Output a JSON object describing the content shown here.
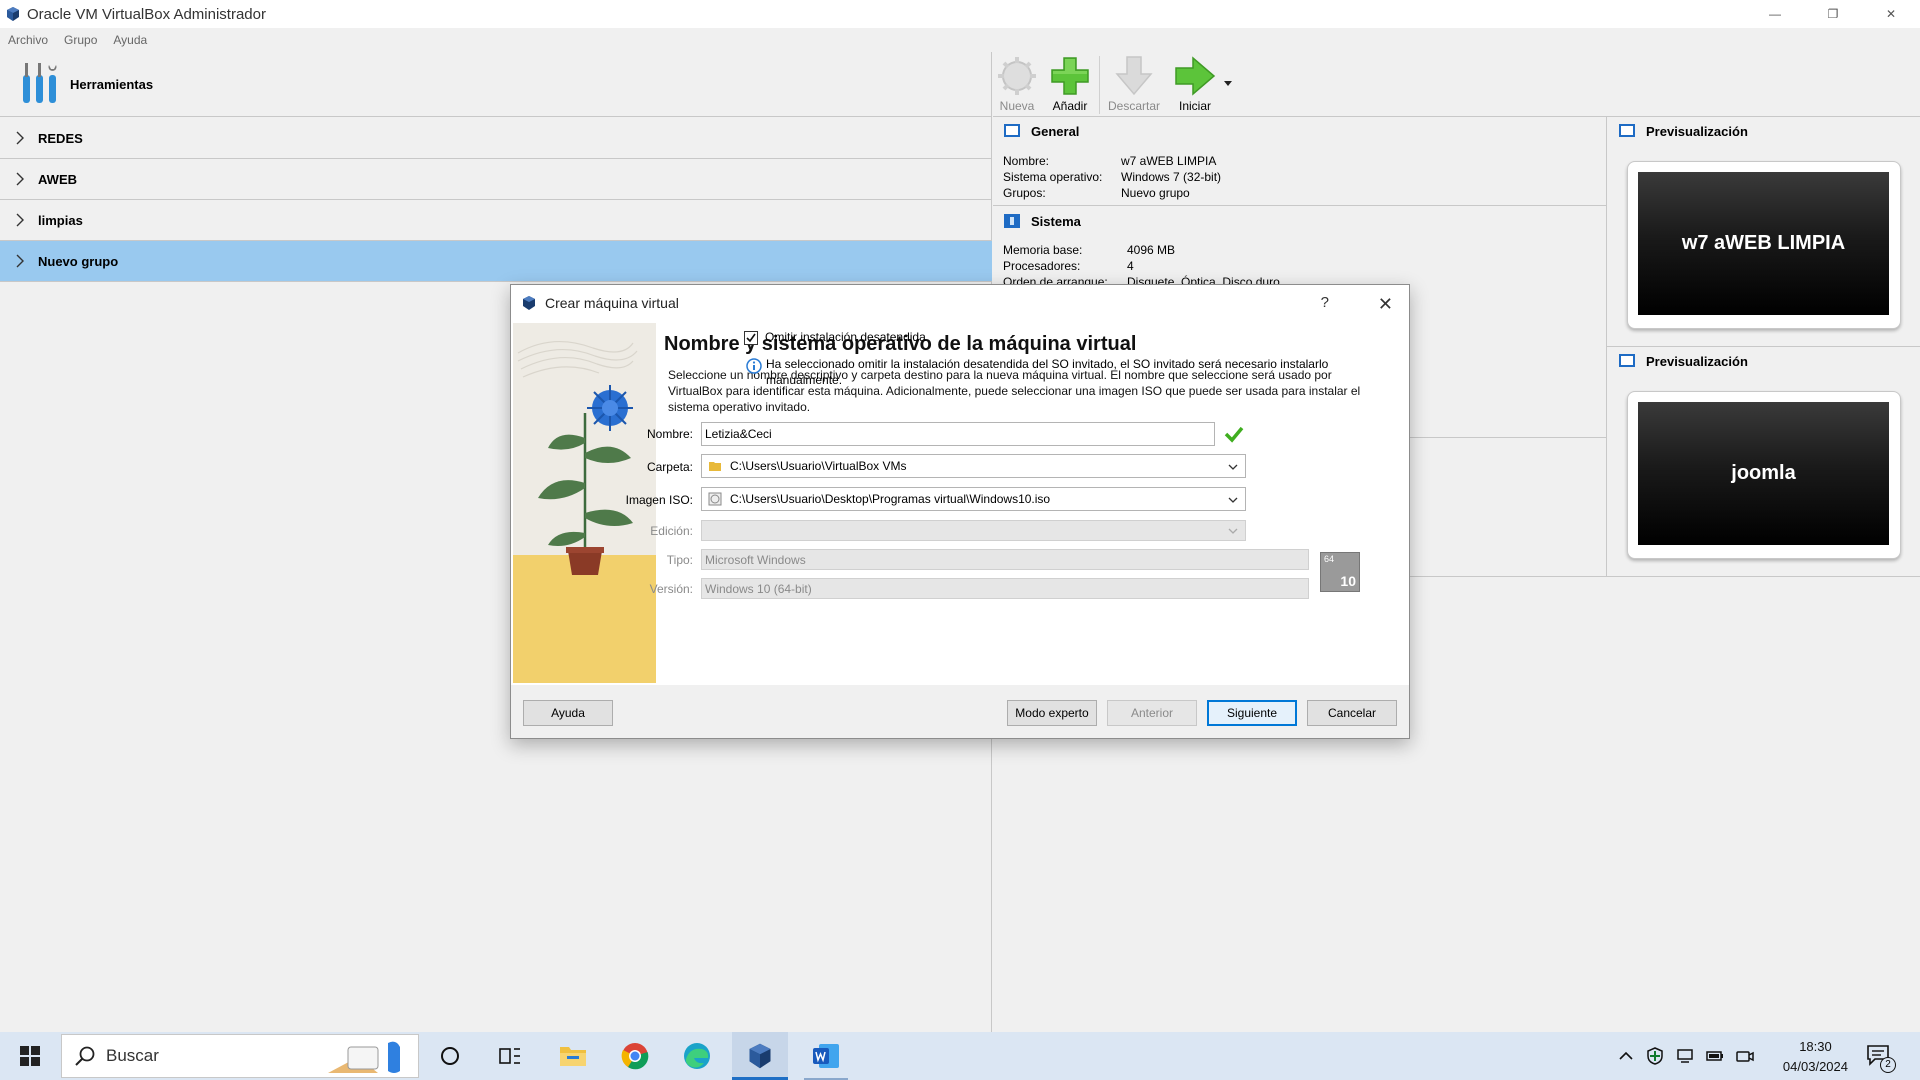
{
  "window": {
    "title": "Oracle VM VirtualBox Administrador",
    "minimize": "—",
    "maximize": "❐",
    "close": "✕"
  },
  "menu": [
    "Archivo",
    "Grupo",
    "Ayuda"
  ],
  "sidebar": {
    "tools_label": "Herramientas",
    "groups": [
      {
        "label": "REDES",
        "selected": false
      },
      {
        "label": "AWEB",
        "selected": false
      },
      {
        "label": "limpias",
        "selected": false
      },
      {
        "label": "Nuevo grupo",
        "selected": true
      }
    ]
  },
  "toolbar": {
    "new_label": "Nueva",
    "add_label": "Añadir",
    "discard_label": "Descartar",
    "start_label": "Iniciar"
  },
  "details": {
    "general_title": "General",
    "general": [
      {
        "key": "Nombre:",
        "value": "w7 aWEB LIMPIA"
      },
      {
        "key": "Sistema operativo:",
        "value": "Windows 7 (32-bit)"
      },
      {
        "key": "Grupos:",
        "value": "Nuevo grupo"
      }
    ],
    "system_title": "Sistema",
    "system": [
      {
        "key": "Memoria base:",
        "value": "4096 MB"
      },
      {
        "key": "Procesadores:",
        "value": "4"
      },
      {
        "key": "Orden de arranque:",
        "value": "Disquete, Óptica, Disco duro"
      }
    ]
  },
  "preview": {
    "title_1": "Previsualización",
    "vm_1": "w7 aWEB LIMPIA",
    "title_2": "Previsualización",
    "vm_2": "joomla"
  },
  "dialog": {
    "title": "Crear máquina virtual",
    "help_glyph": "?",
    "close_glyph": "✕",
    "heading": "Nombre y sistema operativo de la máquina virtual",
    "description": "Seleccione un nombre descriptivo y carpeta destino para la nueva máquina virtual. El nombre que seleccione será usado por VirtualBox para identificar esta máquina. Adicionalmente, puede seleccionar una imagen ISO que puede ser usada para instalar el sistema operativo invitado.",
    "fields": {
      "name_label": "Nombre:",
      "name_value": "Letizia&Ceci",
      "folder_label": "Carpeta:",
      "folder_value": "C:\\Users\\Usuario\\VirtualBox VMs",
      "iso_label": "Imagen ISO:",
      "iso_value": "C:\\Users\\Usuario\\Desktop\\Programas virtual\\Windows10.iso",
      "edition_label": "Edición:",
      "edition_value": "",
      "type_label": "Tipo:",
      "type_value": "Microsoft Windows",
      "version_label": "Versión:",
      "version_value": "Windows 10 (64-bit)",
      "os_badge_top": "64",
      "os_badge_num": "10"
    },
    "unattended_label": "Omitir instalación desatendida",
    "unattended_checked": true,
    "info_text": "Ha seleccionado omitir la instalación desatendida del SO invitado, el SO invitado será necesario instalarlo manualmente.",
    "buttons": {
      "help": "Ayuda",
      "expert": "Modo experto",
      "back": "Anterior",
      "next": "Siguiente",
      "cancel": "Cancelar"
    }
  },
  "taskbar": {
    "search_placeholder": "Buscar",
    "time": "18:30",
    "date": "04/03/2024",
    "notification_count": "2"
  },
  "colors": {
    "selection": "#99c9ef",
    "accent": "#0078d7",
    "taskbar": "#dbe6f3"
  }
}
